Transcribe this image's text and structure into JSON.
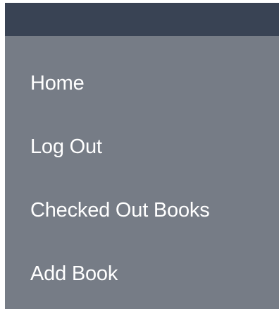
{
  "header": {
    "bar": ""
  },
  "sidebar": {
    "items": [
      {
        "label": "Home"
      },
      {
        "label": "Log Out"
      },
      {
        "label": "Checked Out Books"
      },
      {
        "label": "Add Book"
      }
    ]
  },
  "colors": {
    "topbar": "#394354",
    "panel": "#767c86",
    "text": "#ffffff"
  }
}
